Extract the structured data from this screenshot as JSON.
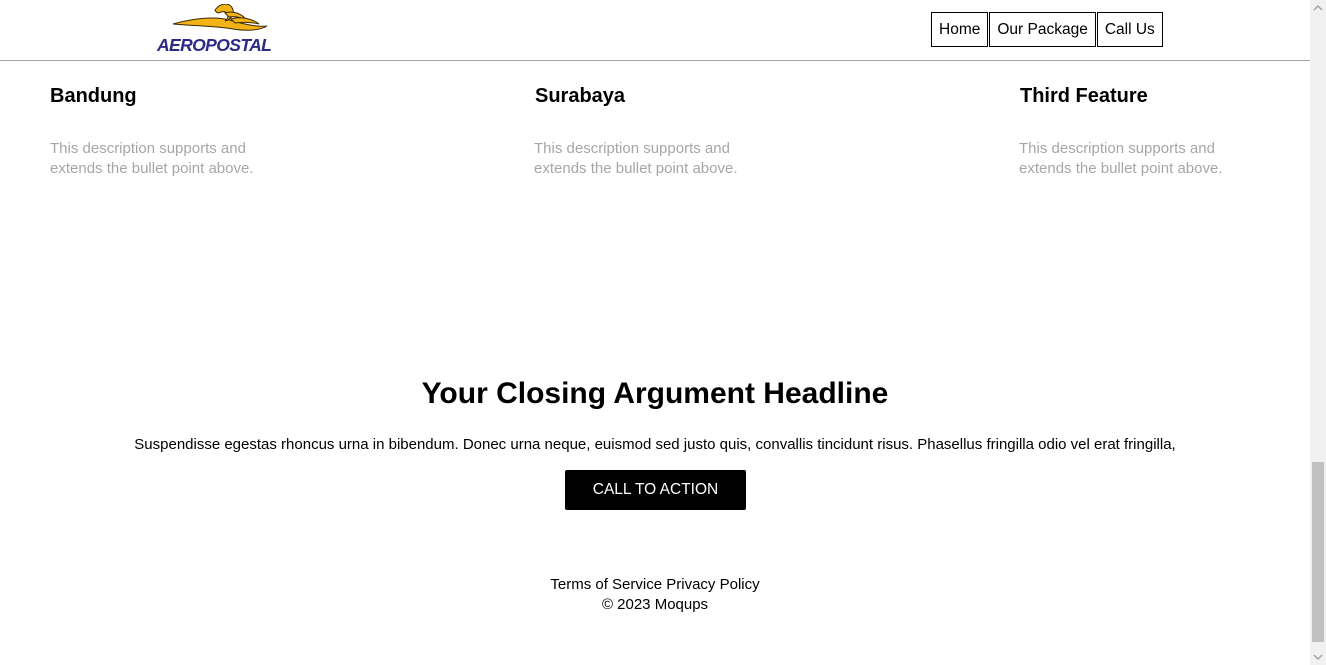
{
  "brand": {
    "logo_text": "AEROPOSTAL",
    "colors": {
      "wing": "#f3b316",
      "text": "#2b2a86"
    }
  },
  "nav": {
    "items": [
      {
        "label": "Home"
      },
      {
        "label": "Our Package"
      },
      {
        "label": "Call Us"
      }
    ]
  },
  "features": [
    {
      "title": "Bandung",
      "description": "This description supports and extends the bullet point above."
    },
    {
      "title": "Surabaya",
      "description": "This description supports and extends the bullet point above."
    },
    {
      "title": "Third Feature",
      "description": "This description supports and extends the bullet point above."
    }
  ],
  "closing": {
    "headline": "Your Closing Argument Headline",
    "text": "Suspendisse egestas rhoncus urna in bibendum. Donec urna neque, euismod sed justo quis, convallis tincidunt risus. Phasellus fringilla odio vel erat fringilla,",
    "cta_label": "CALL TO ACTION"
  },
  "footer": {
    "links": [
      {
        "label": "Terms of Service"
      },
      {
        "label": "Privacy Policy"
      }
    ],
    "copyright": "© 2023 Moqups"
  }
}
